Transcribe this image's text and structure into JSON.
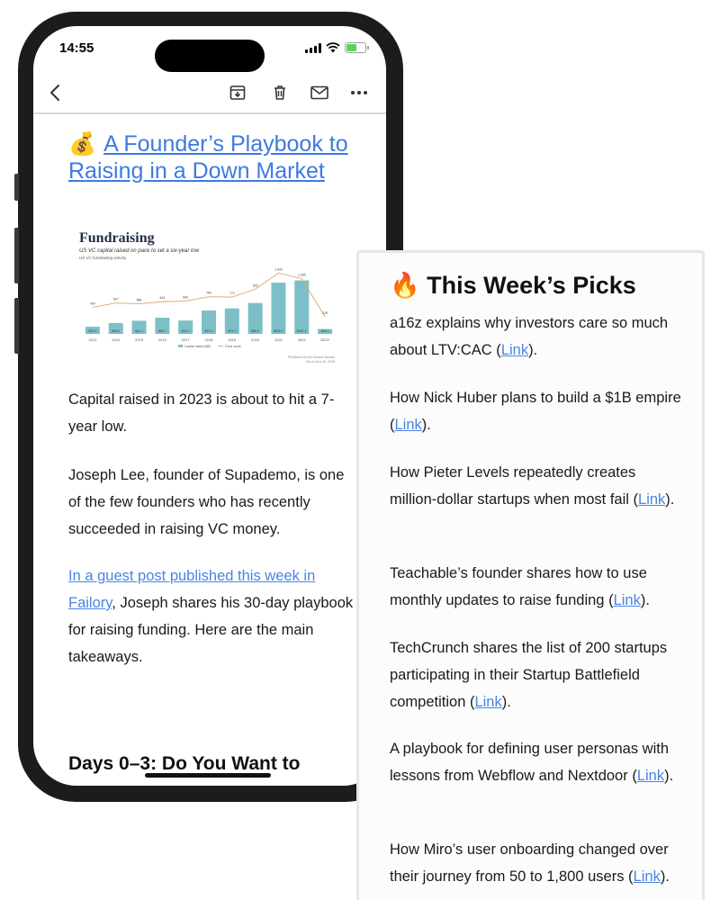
{
  "status": {
    "time": "14:55"
  },
  "toolbar": {
    "back": "back-arrow-icon",
    "archive": "archive-icon",
    "delete": "trash-icon",
    "mail": "mail-icon",
    "more": "more-icon"
  },
  "article": {
    "emoji": "💰",
    "title": "A Founder’s Playbook to Raising in a Down Market",
    "para1": "Capital raised in 2023 is about to hit a 7-year low.",
    "para2": "Joseph Lee, founder of Supademo, is one of the few founders who has recently succeeded in raising VC money.",
    "para3_link": "In a guest post published this week in Failory",
    "para3_rest": ", Joseph shares his 30-day playbook for raising funding. Here are the main takeaways.",
    "section_heading": "Days 0–3: Do You Want to"
  },
  "chart_data": {
    "type": "bar",
    "title": "Fundraising",
    "subtitle": "US VC capital raised on pace to set a six-year low",
    "caption": "US VC fundraising activity",
    "categories": [
      "2013",
      "2014",
      "2015",
      "2016",
      "2017",
      "2018",
      "2019",
      "2020",
      "2021",
      "2022",
      "2023*"
    ],
    "series": [
      {
        "name": "Capital raised ($B)",
        "values": [
          22.3,
          33.9,
          41.1,
          50.7,
          41.7,
          73.1,
          79.7,
          96.5,
          160.1,
          167.1,
          15.1
        ]
      },
      {
        "name": "Fund count",
        "values": [
          490,
          607,
          586,
          644,
          660,
          784,
          772,
          993,
          1442,
          1285,
          228
        ]
      }
    ],
    "bar_labels": [
      "$22.3",
      "$33.9",
      "$41.1",
      "$50.7",
      "$41.7",
      "$73.1",
      "$79.7",
      "$96.5",
      "$160.1",
      "$167.1",
      "$15.1"
    ],
    "line_labels": [
      "490",
      "607",
      "586",
      "644",
      "660",
      "784",
      "772",
      "993",
      "1,442",
      "1,285",
      "228"
    ],
    "source": "PitchBook-NVCA Venture Monitor",
    "asof": "*As of June 30, 2023",
    "colors": {
      "bar": "#7dbfc7",
      "line": "#d9a66b",
      "title": "#1f2d4a"
    }
  },
  "picks": {
    "emoji": "🔥",
    "title": "This Week’s Picks",
    "link_text": "Link",
    "items": [
      {
        "pre": "a16z explains why investors care so much about LTV:CAC (",
        "post": ")."
      },
      {
        "pre": "How Nick Huber plans to build a $1B empire (",
        "post": ")."
      },
      {
        "pre": "How Pieter Levels repeatedly creates million-dollar startups when most fail (",
        "post": ")."
      },
      {
        "pre": "Teachable’s founder shares how to use monthly updates to raise funding (",
        "post": ")."
      },
      {
        "pre": "TechCrunch shares the list of 200 startups participating in their Startup Battlefield competition (",
        "post": ")."
      },
      {
        "pre": "A playbook for defining user personas with lessons from Webflow and Nextdoor (",
        "post": ")."
      },
      {
        "pre": "How Miro’s user onboarding changed over their journey from 50 to 1,800 users (",
        "post": ")."
      }
    ]
  }
}
